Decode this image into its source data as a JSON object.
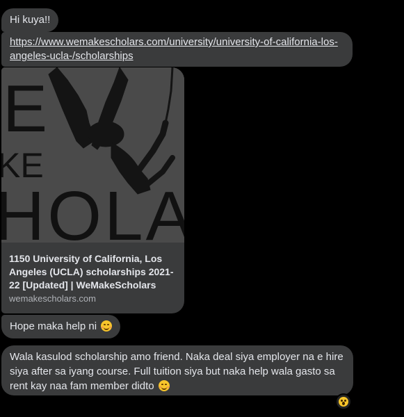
{
  "messages": {
    "greeting": "Hi kuya!!",
    "link_url": "https://www.wemakescholars.com/university/university-of-california-los-angeles-ucla-/scholarships",
    "link_line1": "https://www.wemakescholars.com/university/university-of-california-los-",
    "link_line2": "angeles-ucla-/scholarships",
    "hope": "Hope maka help ni",
    "wala_line1": "Wala kasulod scholarship amo friend. Naka deal siya employer na e hire",
    "wala_line2": "siya after sa iyang course. Full tuition siya but naka help wala gasto sa",
    "wala_line3": "rent kay naa fam member didto"
  },
  "link_preview": {
    "title": "1150 University of California, Los Angeles (UCLA) scholarships 2021-22 [Updated] | WeMakeScholars",
    "domain": "wemakescholars.com",
    "image_text_line1": "E",
    "image_text_line2": "KE",
    "image_text_line3": "HOLAR"
  },
  "emoji": {
    "hope_emoji": "smiling-face-icon",
    "wala_emoji": "smiling-face-icon",
    "reaction": "surprised-face-icon"
  },
  "colors": {
    "background": "#000000",
    "bubble": "#3a3b3c",
    "text": "#e4e6eb",
    "secondary_text": "#b0b3b8"
  }
}
